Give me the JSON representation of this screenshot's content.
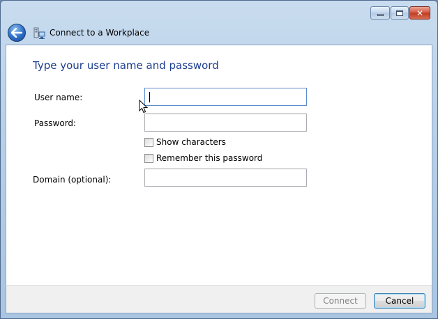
{
  "window": {
    "nav_title": "Connect to a Workplace",
    "caption_buttons": {
      "minimize": "minimize-icon",
      "maximize": "maximize-icon",
      "close": "close-icon"
    }
  },
  "nav": {
    "back_icon": "back-arrow-icon",
    "wizard_icon": "network-workplace-icon"
  },
  "form": {
    "heading": "Type your user name and password",
    "username_label": "User name:",
    "username_value": "",
    "password_label": "Password:",
    "password_value": "",
    "show_characters_label": "Show characters",
    "show_characters_checked": false,
    "remember_password_label": "Remember this password",
    "remember_password_checked": false,
    "domain_label": "Domain (optional):",
    "domain_value": ""
  },
  "footer": {
    "connect_label": "Connect",
    "connect_enabled": false,
    "cancel_label": "Cancel"
  },
  "colors": {
    "heading": "#1c3d8f",
    "titlebar": "#b8d0e8",
    "footer": "#f0f0f0"
  }
}
